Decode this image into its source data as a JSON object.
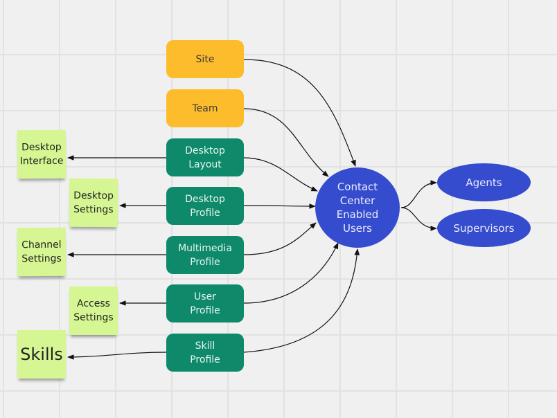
{
  "colors": {
    "background": "#f0f0f0",
    "grid": "#dedede",
    "orange": "#fdbc2c",
    "green": "#0e8a6a",
    "sticky": "#d5f692",
    "blue": "#344ccd"
  },
  "sources": [
    {
      "id": "site",
      "label": "Site",
      "color": "orange"
    },
    {
      "id": "team",
      "label": "Team",
      "color": "orange"
    },
    {
      "id": "desktop-layout",
      "label": "Desktop\nLayout",
      "color": "green"
    },
    {
      "id": "desktop-profile",
      "label": "Desktop\nProfile",
      "color": "green"
    },
    {
      "id": "multimedia-profile",
      "label": "Multimedia\nProfile",
      "color": "green"
    },
    {
      "id": "user-profile",
      "label": "User\nProfile",
      "color": "green"
    },
    {
      "id": "skill-profile",
      "label": "Skill\nProfile",
      "color": "green"
    }
  ],
  "stickies": [
    {
      "label": "Desktop\nInterface",
      "from": "desktop-layout"
    },
    {
      "label": "Desktop\nSettings",
      "from": "desktop-profile"
    },
    {
      "label": "Channel\nSettings",
      "from": "multimedia-profile"
    },
    {
      "label": "Access\nSettings",
      "from": "user-profile"
    },
    {
      "label": "Skills",
      "from": "skill-profile"
    }
  ],
  "center": {
    "label": "Contact\nCenter\nEnabled\nUsers"
  },
  "outputs": [
    {
      "label": "Agents"
    },
    {
      "label": "Supervisors"
    }
  ]
}
